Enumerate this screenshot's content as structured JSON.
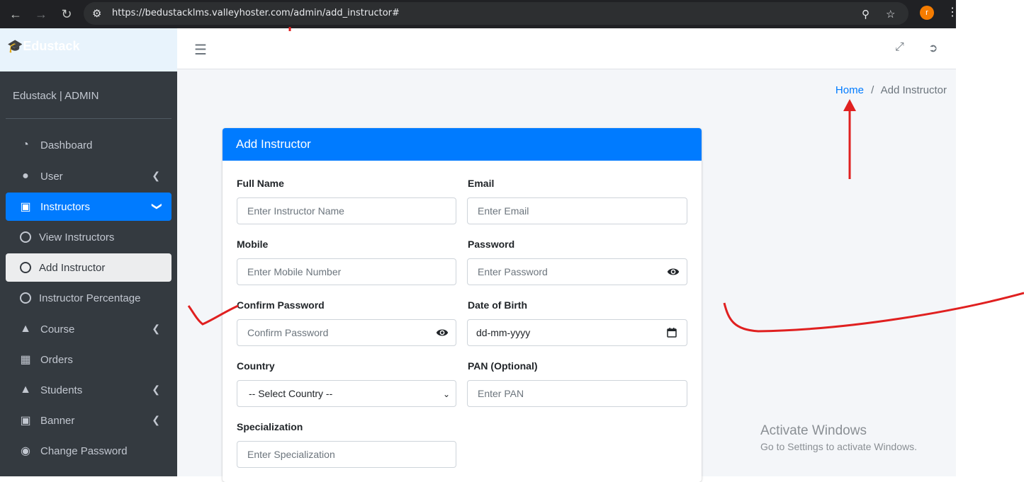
{
  "browser": {
    "url": "https://bedustacklms.valleyhoster.com/admin/add_instructor#",
    "profile_initial": "r"
  },
  "sidebar": {
    "brand": "Edustack",
    "admin_title": "Edustack | ADMIN",
    "items": [
      {
        "label": "Dashboard",
        "icon": "dashboard-icon"
      },
      {
        "label": "User",
        "icon": "user-icon"
      },
      {
        "label": "Instructors",
        "icon": "instructor-icon"
      },
      {
        "label": "View Instructors",
        "icon": "circle-icon"
      },
      {
        "label": "Add Instructor",
        "icon": "circle-icon"
      },
      {
        "label": "Instructor Percentage",
        "icon": "circle-icon"
      },
      {
        "label": "Course",
        "icon": "graduation-cap-icon"
      },
      {
        "label": "Orders",
        "icon": "box-icon"
      },
      {
        "label": "Students",
        "icon": "student-icon"
      },
      {
        "label": "Banner",
        "icon": "image-icon"
      },
      {
        "label": "Change Password",
        "icon": "toggle-icon"
      }
    ]
  },
  "breadcrumb": {
    "home": "Home",
    "separator": "/",
    "current": "Add Instructor"
  },
  "form": {
    "title": "Add Instructor",
    "full_name": {
      "label": "Full Name",
      "placeholder": "Enter Instructor Name"
    },
    "email": {
      "label": "Email",
      "placeholder": "Enter Email"
    },
    "mobile": {
      "label": "Mobile",
      "placeholder": "Enter Mobile Number"
    },
    "password": {
      "label": "Password",
      "placeholder": "Enter Password"
    },
    "confirm_password": {
      "label": "Confirm Password",
      "placeholder": "Confirm Password"
    },
    "dob": {
      "label": "Date of Birth",
      "placeholder": "dd-mm-yyyy"
    },
    "country": {
      "label": "Country",
      "selected": "-- Select Country --"
    },
    "pan": {
      "label": "PAN (Optional)",
      "placeholder": "Enter PAN"
    },
    "specialization": {
      "label": "Specialization",
      "placeholder": "Enter Specialization"
    }
  },
  "watermark": {
    "line1": "Activate Windows",
    "line2": "Go to Settings to activate Windows."
  },
  "colors": {
    "primary": "#007bff",
    "sidebar": "#343a40",
    "annotation": "#e02020"
  }
}
